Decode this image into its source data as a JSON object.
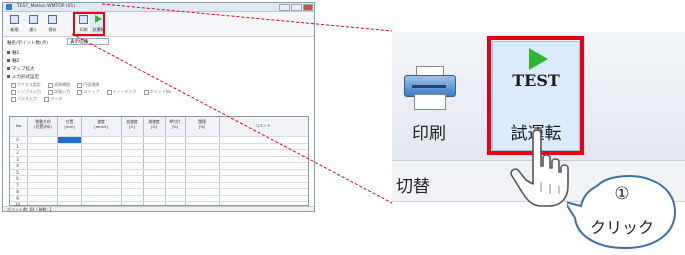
{
  "mini_app": {
    "title": "TEST_Motion.WMTOP (01)",
    "ribbon": [
      {
        "label": "新規",
        "icon": "new-file-icon"
      },
      {
        "label": "開く",
        "icon": "open-folder-icon"
      },
      {
        "label": "保存",
        "icon": "save-icon"
      },
      {
        "label": "印刷",
        "icon": "printer-icon"
      },
      {
        "label": "試運転",
        "icon": "play-icon"
      }
    ],
    "subline_label": "軸名/ポイント数(点)",
    "subline_value": "表示切替",
    "tree": [
      "軸1",
      "軸2",
      "マップ拡大",
      "入力形式設定"
    ],
    "options_row1": [
      "アクセス設定",
      "直線補間",
      "円弧補間"
    ],
    "options_row2": [
      "シンプル入力",
      "詳細入力",
      "ステップ",
      "ティーチング",
      "ポイントNo"
    ],
    "options_row3": [
      "パルス入力",
      "データ"
    ],
    "table_headers": [
      "No.",
      "移動方向\n(位置決め)",
      "位置\n[mm]",
      "速度\n[mm/s]",
      "加速度\n[G]",
      "減速度\n[G]",
      "押付け\n[%]",
      "閾値\n[%]",
      "コメント"
    ],
    "row_numbers": [
      "0",
      "1",
      "2",
      "3",
      "4",
      "5",
      "6",
      "7",
      "8",
      "9",
      "10"
    ],
    "status": "ポイント数: 64 / 軸数: 1"
  },
  "zoom": {
    "print_label": "印刷",
    "test_label": "TEST",
    "run_label": "試運転",
    "lower_label": "切替"
  },
  "callout": {
    "number": "①",
    "label": "クリック"
  },
  "colors": {
    "highlight": "#e60012",
    "play": "#2fb52f",
    "connector": "#e60012"
  }
}
